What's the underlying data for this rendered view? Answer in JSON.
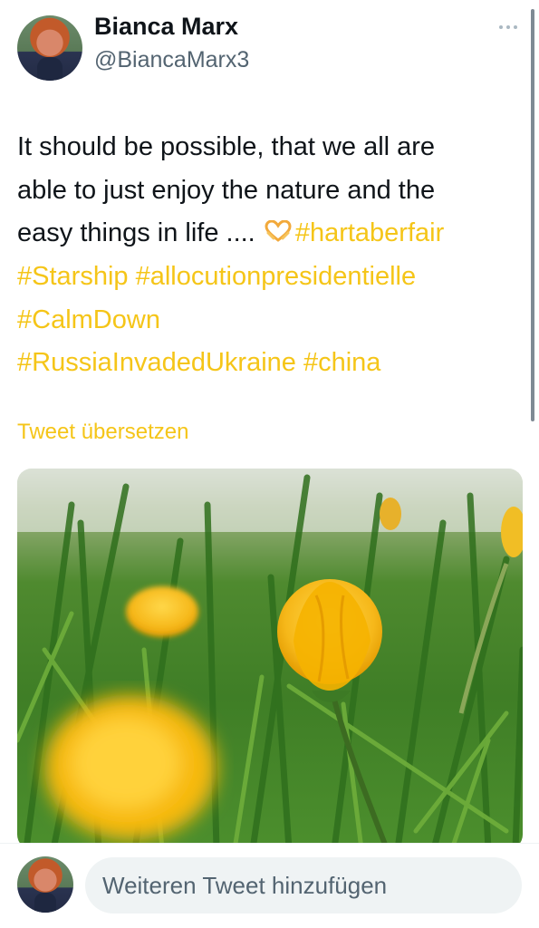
{
  "author": {
    "display_name": "Bianca Marx",
    "handle": "@BiancaMarx3"
  },
  "tweet": {
    "text_lines": [
      "It should be possible, that we all are",
      "able to just enjoy the nature and the",
      "easy things in life .... "
    ],
    "hashtags": [
      "#hartaberfair",
      "#Starship",
      "#allocutionpresidentielle",
      "#CalmDown",
      "#RussiaInvadedUkraine",
      "#china"
    ],
    "emoji_icon": "heart-hands-icon",
    "translate_label": "Tweet übersetzen",
    "photo_icon": "buttercup-photo"
  },
  "compose": {
    "placeholder": "Weiteren Tweet hinzufügen"
  },
  "colors": {
    "accent": "#f5c518",
    "text": "#0f1419",
    "secondary": "#536471",
    "input_bg": "#eff3f4"
  }
}
